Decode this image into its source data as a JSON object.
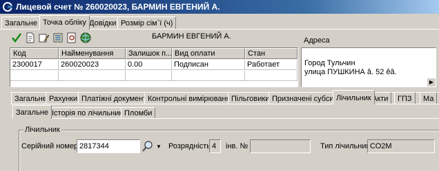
{
  "window": {
    "title": "Лицевой счет № 260020023, БАРМИН ЕВГЕНИЙ А."
  },
  "top_tabs": [
    "Загальне",
    "Точка обліку",
    "Довідки",
    "Розмір сім`ї (ч)"
  ],
  "toolbar": {
    "icons": [
      "check-icon",
      "document-icon",
      "edit-icon",
      "settings-icon",
      "list-icon",
      "globe-icon"
    ],
    "owner_name": "БАРМИН ЕВГЕНИЙ А."
  },
  "table": {
    "columns": [
      "Код",
      "Найменування",
      "Залишок п...",
      "Вид оплати",
      "Стан"
    ],
    "rows": [
      [
        "2300017",
        "260020023",
        "0.00",
        "Подписан",
        "Работает"
      ]
    ]
  },
  "address": {
    "label": "Адреса",
    "lines": [
      "Город Тульчин",
      "улица ПУШКИНА â. 52 êâ."
    ]
  },
  "mid_tabs": [
    "Загальне",
    "Рахунки",
    "Платіжні документи",
    "Контрольні вимірювання",
    "Пільговики",
    "Призначені субсидії",
    "Лічильник",
    "Акти",
    "ГПЗ",
    "Ма"
  ],
  "sub_tabs": [
    "Загальне",
    "Історія по лічильнику",
    "Пломби"
  ],
  "meter": {
    "group_label": "Лічильник",
    "serial_label": "Серійний номер",
    "serial_value": "2817344",
    "digits_label": "Розрядність",
    "digits_value": "4",
    "inv_label": "інв. №",
    "inv_value": "",
    "type_label": "Тип лічильника",
    "type_value": "СО2М"
  }
}
